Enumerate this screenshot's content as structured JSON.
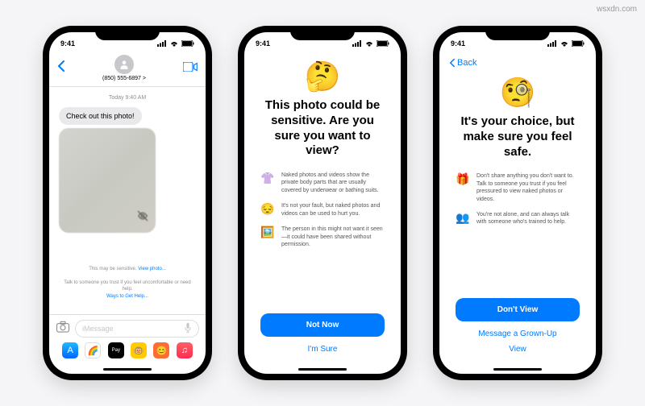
{
  "watermark": "wsxdn.com",
  "status": {
    "time": "9:41"
  },
  "phone1": {
    "contact": "(850) 555-6897 >",
    "timestamp": "Today 9:40 AM",
    "message": "Check out this photo!",
    "sensitive_label": "This may be sensitive.",
    "view_link": "View photo...",
    "advice1": "Talk to someone you trust if you feel uncomfortable or need help.",
    "ways_link": "Ways to Get Help...",
    "input_placeholder": "iMessage"
  },
  "phone2": {
    "emoji": "🤔",
    "title": "This photo could be sensitive. Are you sure you want to view?",
    "bullets": [
      {
        "icon": "👚",
        "text": "Naked photos and videos show the private body parts that are usually covered by underwear or bathing suits."
      },
      {
        "icon": "😔",
        "text": "It's not your fault, but naked photos and videos can be used to hurt you."
      },
      {
        "icon": "🖼️",
        "text": "The person in this might not want it seen—it could have been shared without permission."
      }
    ],
    "primary": "Not Now",
    "secondary": "I'm Sure"
  },
  "phone3": {
    "back": "Back",
    "emoji": "🧐",
    "title": "It's your choice, but make sure you feel safe.",
    "bullets": [
      {
        "icon": "🎁",
        "text": "Don't share anything you don't want to. Talk to someone you trust if you feel pressured to view naked photos or videos."
      },
      {
        "icon": "👥",
        "text": "You're not alone, and can always talk with someone who's trained to help."
      }
    ],
    "primary": "Don't View",
    "secondary1": "Message a Grown-Up",
    "secondary2": "View"
  }
}
